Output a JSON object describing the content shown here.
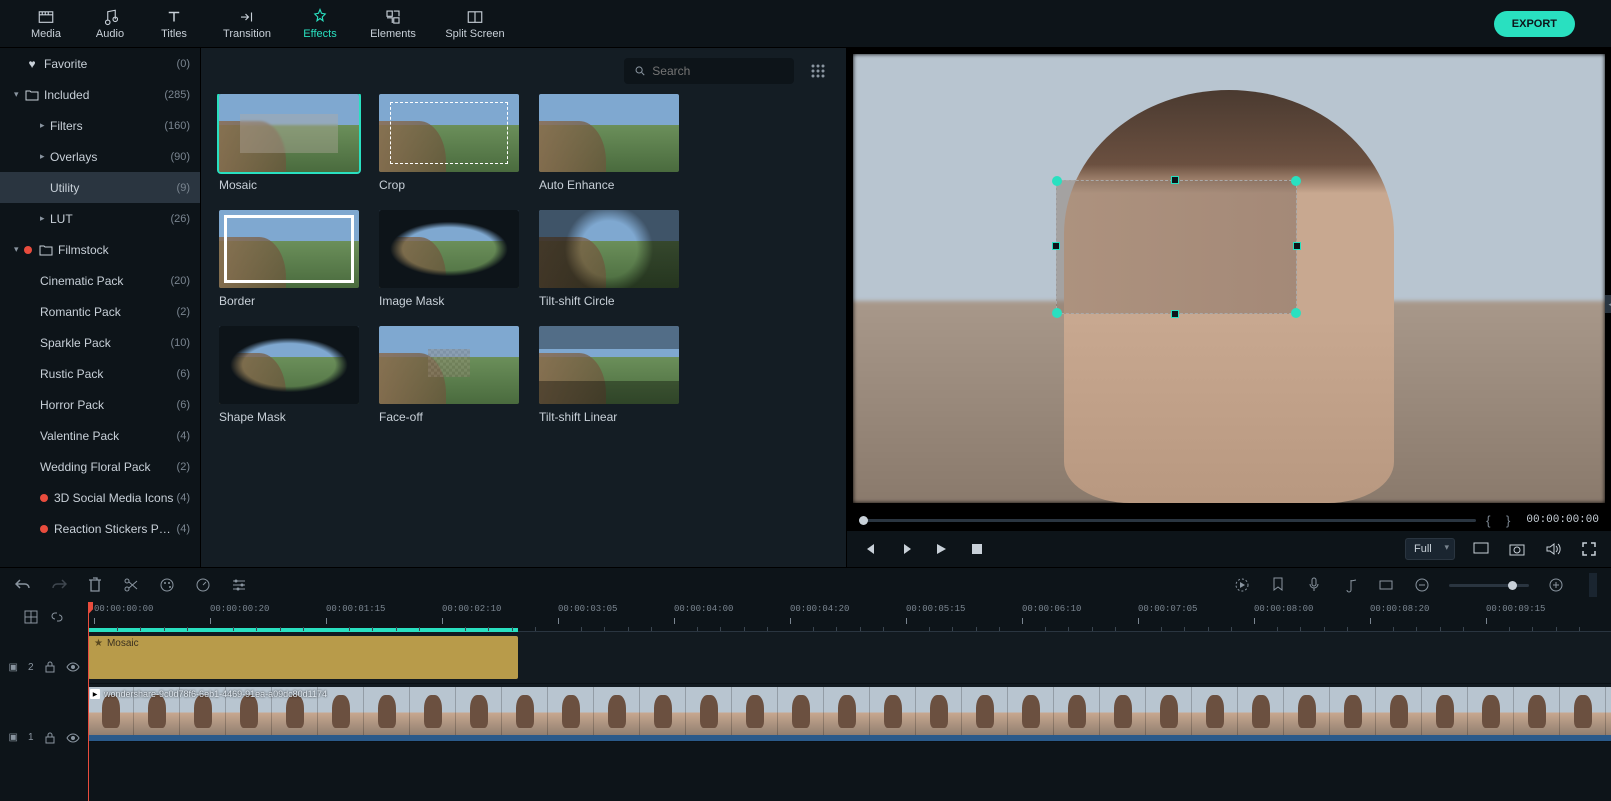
{
  "nav": {
    "media": "Media",
    "audio": "Audio",
    "titles": "Titles",
    "transition": "Transition",
    "effects": "Effects",
    "elements": "Elements",
    "splitscreen": "Split Screen",
    "export": "EXPORT"
  },
  "search": {
    "placeholder": "Search"
  },
  "sidebar": {
    "items": [
      {
        "label": "Favorite",
        "count": "(0)",
        "chev": "",
        "icon": "heart",
        "indent": 0
      },
      {
        "label": "Included",
        "count": "(285)",
        "chev": "▾",
        "icon": "folder",
        "indent": 0
      },
      {
        "label": "Filters",
        "count": "(160)",
        "chev": "▸",
        "icon": "",
        "indent": 2
      },
      {
        "label": "Overlays",
        "count": "(90)",
        "chev": "▸",
        "icon": "",
        "indent": 2
      },
      {
        "label": "Utility",
        "count": "(9)",
        "chev": "",
        "icon": "",
        "indent": 2,
        "selected": true
      },
      {
        "label": "LUT",
        "count": "(26)",
        "chev": "▸",
        "icon": "",
        "indent": 2
      },
      {
        "label": "Filmstock",
        "count": "",
        "chev": "▾",
        "icon": "folder",
        "indent": 0,
        "dot": true
      },
      {
        "label": "Cinematic Pack",
        "count": "(20)",
        "indent": 2
      },
      {
        "label": "Romantic Pack",
        "count": "(2)",
        "indent": 2
      },
      {
        "label": "Sparkle Pack",
        "count": "(10)",
        "indent": 2
      },
      {
        "label": "Rustic Pack",
        "count": "(6)",
        "indent": 2
      },
      {
        "label": "Horror Pack",
        "count": "(6)",
        "indent": 2
      },
      {
        "label": "Valentine Pack",
        "count": "(4)",
        "indent": 2
      },
      {
        "label": "Wedding Floral Pack",
        "count": "(2)",
        "indent": 2
      },
      {
        "label": "3D Social Media Icons",
        "count": "(4)",
        "indent": 2,
        "dot": true
      },
      {
        "label": "Reaction Stickers Pack",
        "count": "(4)",
        "indent": 2,
        "dot": true
      }
    ]
  },
  "effects": [
    {
      "label": "Mosaic",
      "overlay": "blur",
      "selected": true
    },
    {
      "label": "Crop",
      "overlay": "dashed"
    },
    {
      "label": "Auto Enhance",
      "overlay": ""
    },
    {
      "label": "Border",
      "overlay": "border"
    },
    {
      "label": "Image Mask",
      "overlay": "ellipse"
    },
    {
      "label": "Tilt-shift Circle",
      "overlay": "circle"
    },
    {
      "label": "Shape Mask",
      "overlay": "ellipse"
    },
    {
      "label": "Face-off",
      "overlay": "pixel"
    },
    {
      "label": "Tilt-shift Linear",
      "overlay": "linear"
    }
  ],
  "preview": {
    "time": "00:00:00:00",
    "quality": "Full"
  },
  "timeline": {
    "ticks": [
      "00:00:00:00",
      "00:00:00:20",
      "00:00:01:15",
      "00:00:02:10",
      "00:00:03:05",
      "00:00:04:00",
      "00:00:04:20",
      "00:00:05:15",
      "00:00:06:10",
      "00:00:07:05",
      "00:00:08:00",
      "00:00:08:20",
      "00:00:09:15"
    ],
    "effect_clip": "Mosaic",
    "video_clip": "wondershare-9c0d78f6-6eb1-4469-91ea-a09dc80d1174",
    "track_effect": "2",
    "track_video": "1"
  }
}
